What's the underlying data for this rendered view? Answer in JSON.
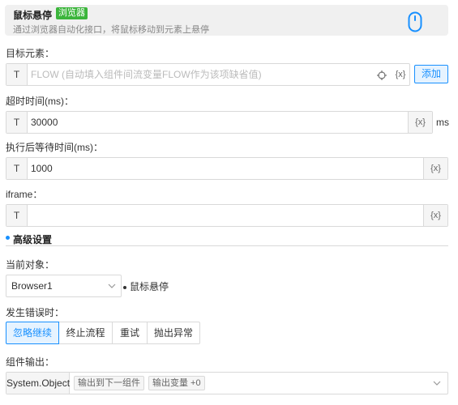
{
  "header": {
    "title": "鼠标悬停",
    "badge": "浏览器",
    "description": "通过浏览器自动化接口，将鼠标移动到元素上悬停",
    "icon": "mouse-icon"
  },
  "target": {
    "label": "目标元素：",
    "type_label": "T",
    "placeholder": "FLOW (自动填入组件间流变量FLOW作为该项缺省值)",
    "var_button": "{x}",
    "add_button": "添加",
    "target_icon": "crosshair-icon"
  },
  "timeout": {
    "label": "超时时间(ms)：",
    "type_label": "T",
    "value": "30000",
    "var_button": "{x}",
    "unit": "ms"
  },
  "wait": {
    "label": "执行后等待时间(ms)：",
    "type_label": "T",
    "value": "1000",
    "var_button": "{x}"
  },
  "iframe": {
    "label": "iframe：",
    "type_label": "T",
    "value": "",
    "var_button": "{x}"
  },
  "advanced": {
    "title": "高级设置"
  },
  "current_object": {
    "label": "当前对象：",
    "selected": "Browser1",
    "hint": "鼠标悬停"
  },
  "on_error": {
    "label": "发生错误时：",
    "options": [
      "忽略继续",
      "终止流程",
      "重试",
      "抛出异常"
    ],
    "active_index": 0
  },
  "output": {
    "label": "组件输出：",
    "type": "System.Object",
    "tags": [
      "输出到下一组件",
      "输出变量 +0"
    ]
  },
  "colors": {
    "accent": "#1890ff",
    "badge": "#3bb53b"
  }
}
